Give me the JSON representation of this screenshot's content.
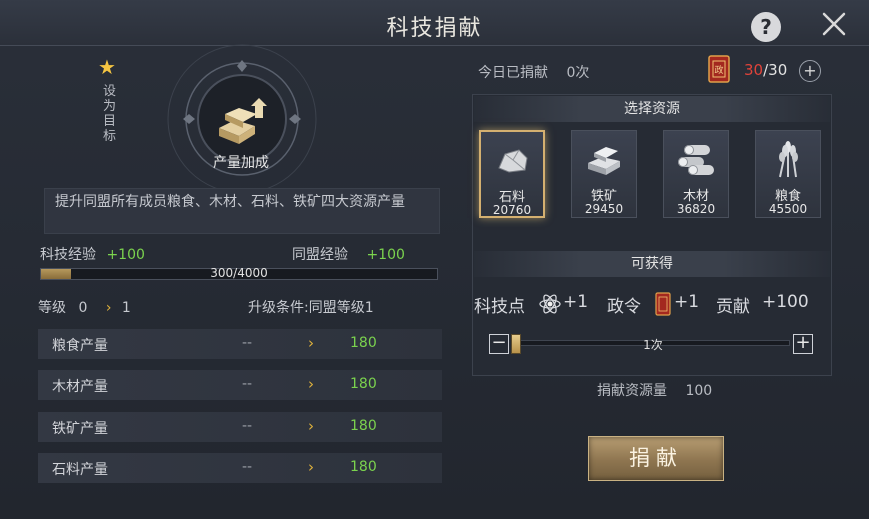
{
  "header": {
    "title": "科技捐献",
    "help_icon": "question-icon",
    "close_icon": "close-icon"
  },
  "tech": {
    "set_target_label": "设为目标",
    "name": "产量加成",
    "description": "提升同盟所有成员粮食、木材、石料、铁矿四大资源产量",
    "tech_exp_label": "科技经验",
    "tech_exp_value": "+100",
    "alliance_exp_label": "同盟经验",
    "alliance_exp_value": "+100",
    "progress_text": "300/4000",
    "progress_fraction": 0.075,
    "level_label": "等级",
    "level_current": "0",
    "level_next": "1",
    "upgrade_condition": "升级条件:同盟等级1",
    "stats": [
      {
        "name": "粮食产量",
        "current": "--",
        "next": "180"
      },
      {
        "name": "木材产量",
        "current": "--",
        "next": "180"
      },
      {
        "name": "铁矿产量",
        "current": "--",
        "next": "180"
      },
      {
        "name": "石料产量",
        "current": "--",
        "next": "180"
      }
    ]
  },
  "donation": {
    "today_label": "今日已捐献",
    "today_value": "0次",
    "remaining": "30",
    "max": "/30",
    "select_header": "选择资源",
    "resources": [
      {
        "name": "石料",
        "value": "20760",
        "icon": "stone-icon",
        "selected": true
      },
      {
        "name": "铁矿",
        "value": "29450",
        "icon": "iron-ingot-icon",
        "selected": false
      },
      {
        "name": "木材",
        "value": "36820",
        "icon": "wood-logs-icon",
        "selected": false
      },
      {
        "name": "粮食",
        "value": "45500",
        "icon": "wheat-icon",
        "selected": false
      }
    ],
    "gain_header": "可获得",
    "gains": [
      {
        "label": "科技点",
        "value": "+1",
        "icon": "tech-point-icon"
      },
      {
        "label": "政令",
        "value": "+1",
        "icon": "decree-token-icon"
      },
      {
        "label": "贡献",
        "value": "+100"
      }
    ],
    "slider_value": "1次",
    "amount_label": "捐献资源量",
    "amount_value": "100",
    "donate_button": "捐献"
  },
  "colors": {
    "accent_gold": "#d4b070",
    "green": "#7bd34e",
    "red": "#e0433a"
  }
}
